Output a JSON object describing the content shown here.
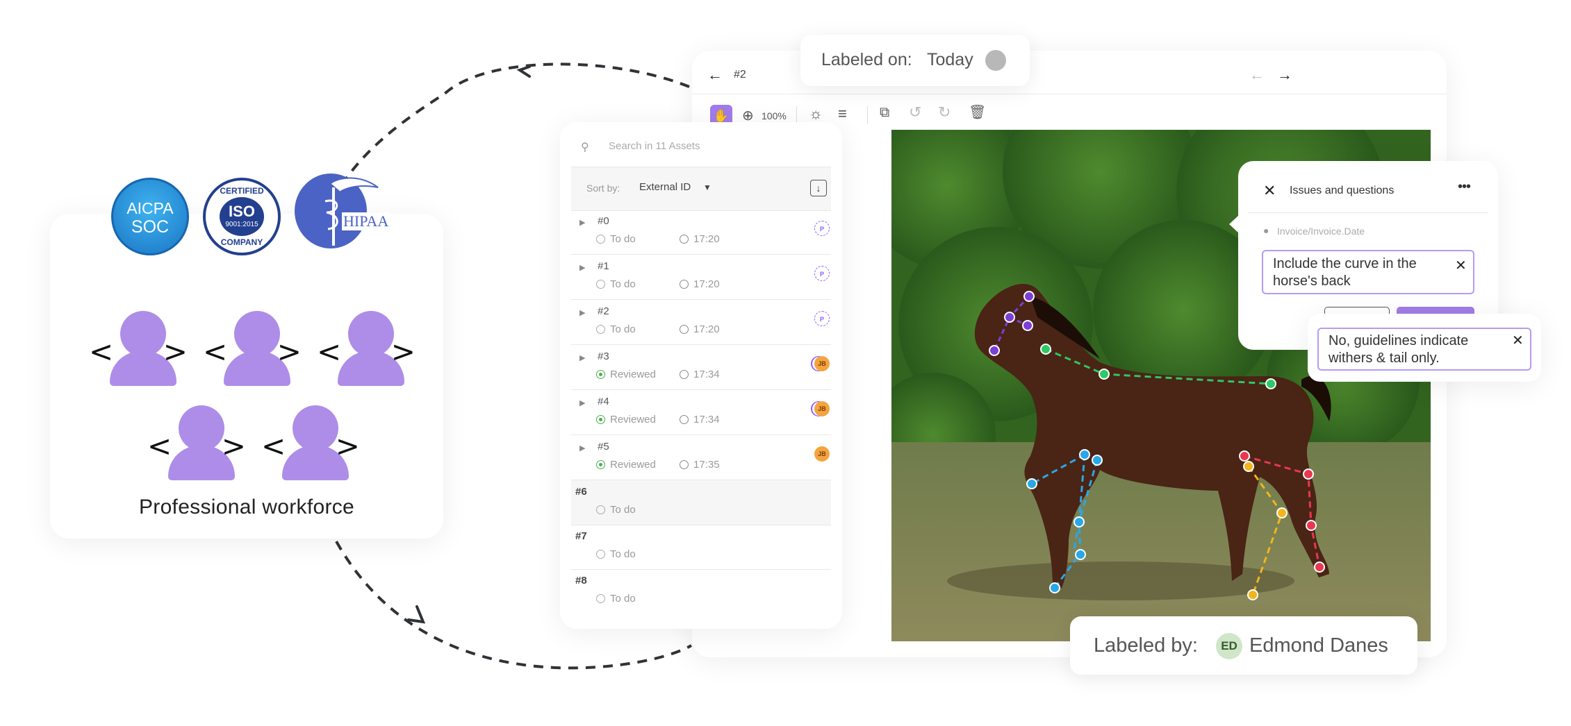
{
  "workforce": {
    "label": "Professional workforce",
    "badges": [
      {
        "icon": "aicpa-soc-icon",
        "lines": [
          "AICPA",
          "SOC"
        ],
        "color": "#1e88d0"
      },
      {
        "icon": "iso-certified-icon",
        "top": "CERTIFIED",
        "main": "ISO",
        "sub": "9001:2015",
        "bottom": "COMPANY",
        "color": "#233f8f"
      },
      {
        "icon": "hipaa-icon",
        "text": "HIPAA",
        "color": "#4a63c4"
      }
    ]
  },
  "labeled_on": {
    "label": "Labeled on:",
    "value": "Today"
  },
  "labeled_by": {
    "label": "Labeled by:",
    "initials": "ED",
    "name": "Edmond Danes"
  },
  "editor": {
    "asset_id": "#2",
    "zoom": "100%"
  },
  "assets": {
    "search_placeholder": "Search in 11 Assets",
    "sort_label": "Sort by:",
    "sort_value": "External ID",
    "rows": [
      {
        "id": "#0",
        "status": "To do",
        "time": "17:20",
        "avatar": "P",
        "reviewed": false
      },
      {
        "id": "#1",
        "status": "To do",
        "time": "17:20",
        "avatar": "P",
        "reviewed": false
      },
      {
        "id": "#2",
        "status": "To do",
        "time": "17:20",
        "avatar": "P",
        "reviewed": false
      },
      {
        "id": "#3",
        "status": "Reviewed",
        "time": "17:34",
        "avatar": "JB",
        "reviewed": true
      },
      {
        "id": "#4",
        "status": "Reviewed",
        "time": "17:34",
        "avatar": "JB",
        "reviewed": true
      },
      {
        "id": "#5",
        "status": "Reviewed",
        "time": "17:35",
        "avatar": "JB",
        "reviewed": true
      }
    ],
    "flat_rows": [
      {
        "id": "#6",
        "status": "To do"
      },
      {
        "id": "#7",
        "status": "To do"
      },
      {
        "id": "#8",
        "status": "To do"
      }
    ]
  },
  "issues": {
    "title": "Issues and questions",
    "path": "Invoice/Invoice.Date",
    "question": "Include the curve in the horse's back",
    "reply": "No, guidelines indicate withers & tail only."
  },
  "colors": {
    "accent": "#a07ce8",
    "keypoint_purple": "#7b3fd6",
    "keypoint_green": "#2ec866",
    "keypoint_blue": "#2aa7e8",
    "keypoint_red": "#e8384f",
    "keypoint_yellow": "#f2b51d"
  }
}
